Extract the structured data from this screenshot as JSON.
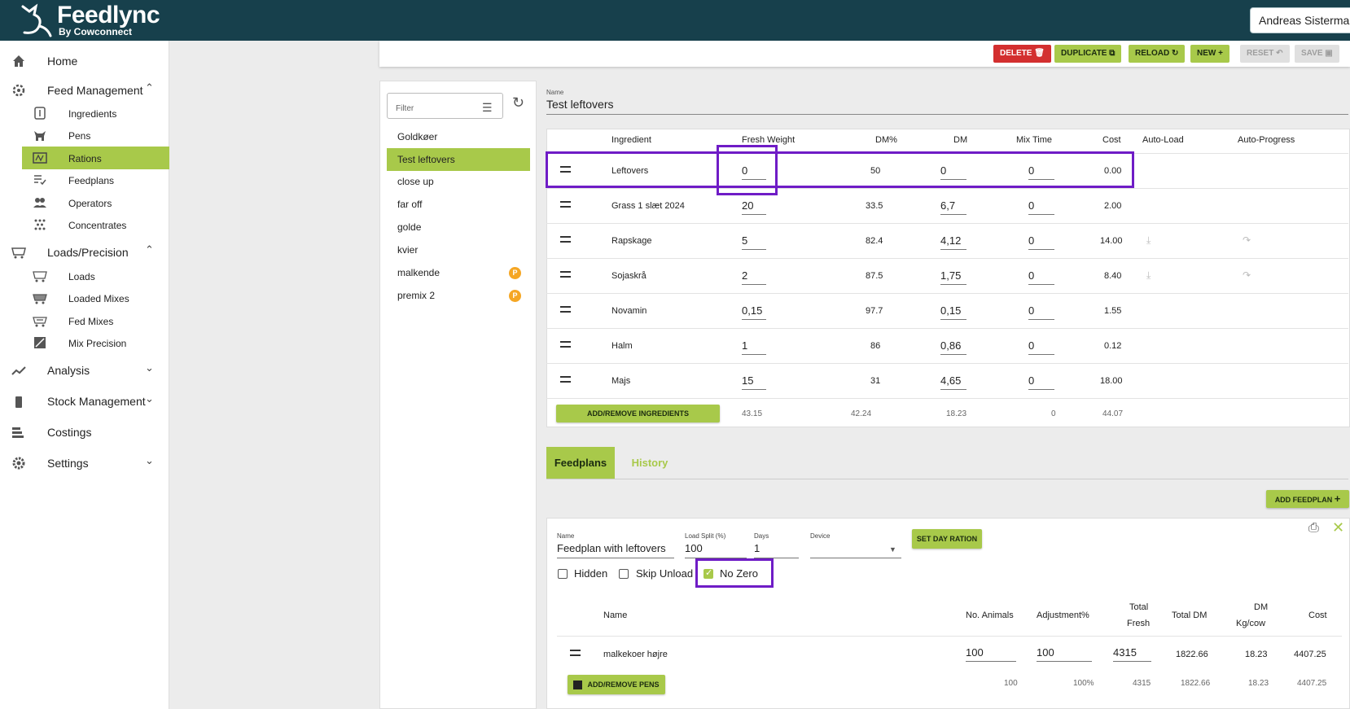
{
  "app": {
    "name": "Feedlync",
    "subtitle": "By Cowconnect",
    "user": "Andreas Sisterman"
  },
  "sidebar": {
    "home": "Home",
    "feed_management": "Feed Management",
    "ingredients": "Ingredients",
    "pens": "Pens",
    "rations": "Rations",
    "feedplans": "Feedplans",
    "operators": "Operators",
    "concentrates": "Concentrates",
    "loads_precision": "Loads/Precision",
    "loads": "Loads",
    "loaded_mixes": "Loaded Mixes",
    "fed_mixes": "Fed Mixes",
    "mix_precision": "Mix Precision",
    "analysis": "Analysis",
    "stock_management": "Stock Management",
    "costings": "Costings",
    "settings": "Settings"
  },
  "actions": {
    "delete": "DELETE",
    "duplicate": "DUPLICATE",
    "reload": "RELOAD",
    "new": "NEW",
    "reset": "RESET",
    "save": "SAVE"
  },
  "list": {
    "filter_placeholder": "Filter",
    "items": [
      {
        "label": "Goldkøer",
        "badge": ""
      },
      {
        "label": "Test leftovers",
        "badge": ""
      },
      {
        "label": "close up",
        "badge": ""
      },
      {
        "label": "far off",
        "badge": ""
      },
      {
        "label": "golde",
        "badge": ""
      },
      {
        "label": "kvier",
        "badge": ""
      },
      {
        "label": "malkende",
        "badge": "P"
      },
      {
        "label": "premix 2",
        "badge": "P"
      }
    ]
  },
  "ration": {
    "name_label": "Name",
    "name": "Test leftovers",
    "columns": {
      "ingredient": "Ingredient",
      "fresh_weight": "Fresh Weight",
      "dm_pct": "DM%",
      "dm": "DM",
      "mix_time": "Mix Time",
      "cost": "Cost",
      "auto_load": "Auto-Load",
      "auto_progress": "Auto-Progress"
    },
    "rows": [
      {
        "ingredient": "Leftovers",
        "fresh": "0",
        "dm_pct": "50",
        "dm": "0",
        "mix": "0",
        "cost": "0.00"
      },
      {
        "ingredient": "Grass 1 slæt 2024",
        "fresh": "20",
        "dm_pct": "33.5",
        "dm": "6,7",
        "mix": "0",
        "cost": "2.00"
      },
      {
        "ingredient": "Rapskage",
        "fresh": "5",
        "dm_pct": "82.4",
        "dm": "4,12",
        "mix": "0",
        "cost": "14.00"
      },
      {
        "ingredient": "Sojaskrå",
        "fresh": "2",
        "dm_pct": "87.5",
        "dm": "1,75",
        "mix": "0",
        "cost": "8.40"
      },
      {
        "ingredient": "Novamin",
        "fresh": "0,15",
        "dm_pct": "97.7",
        "dm": "0,15",
        "mix": "0",
        "cost": "1.55"
      },
      {
        "ingredient": "Halm",
        "fresh": "1",
        "dm_pct": "86",
        "dm": "0,86",
        "mix": "0",
        "cost": "0.12"
      },
      {
        "ingredient": "Majs",
        "fresh": "15",
        "dm_pct": "31",
        "dm": "4,65",
        "mix": "0",
        "cost": "18.00"
      }
    ],
    "add_remove": "ADD/REMOVE INGREDIENTS",
    "totals": {
      "fresh": "43.15",
      "dm_pct": "42.24",
      "dm": "18.23",
      "mix": "0",
      "cost": "44.07"
    }
  },
  "tabs": {
    "feedplans": "Feedplans",
    "history": "History"
  },
  "feedplan": {
    "add_button": "ADD FEEDPLAN",
    "name_label": "Name",
    "name": "Feedplan with leftovers",
    "load_split_label": "Load Split (%)",
    "load_split": "100",
    "days_label": "Days",
    "days": "1",
    "device_label": "Device",
    "device": "",
    "set_day_ration": "SET DAY RATION",
    "hidden": "Hidden",
    "skip_unload": "Skip Unload",
    "no_zero": "No Zero",
    "columns": {
      "name": "Name",
      "animals": "No. Animals",
      "adjustment": "Adjustment%",
      "total_fresh_1": "Total",
      "total_fresh_2": "Fresh",
      "total_dm": "Total DM",
      "dm_kg_1": "DM",
      "dm_kg_2": "Kg/cow",
      "cost": "Cost"
    },
    "rows": [
      {
        "name": "malkekoer højre",
        "animals": "100",
        "adjustment": "100",
        "fresh": "4315",
        "total_dm": "1822.66",
        "dm_kg": "18.23",
        "cost": "4407.25"
      }
    ],
    "add_remove_pens": "ADD/REMOVE PENS",
    "totals": {
      "animals": "100",
      "adjustment": "100%",
      "fresh": "4315",
      "total_dm": "1822.66",
      "dm_kg": "18.23",
      "cost": "4407.25"
    }
  },
  "colors": {
    "brand": "#17404c",
    "accent": "#a8c94a",
    "danger": "#d32f2f",
    "highlight": "#6f1cc6",
    "badge": "#f5a623"
  }
}
